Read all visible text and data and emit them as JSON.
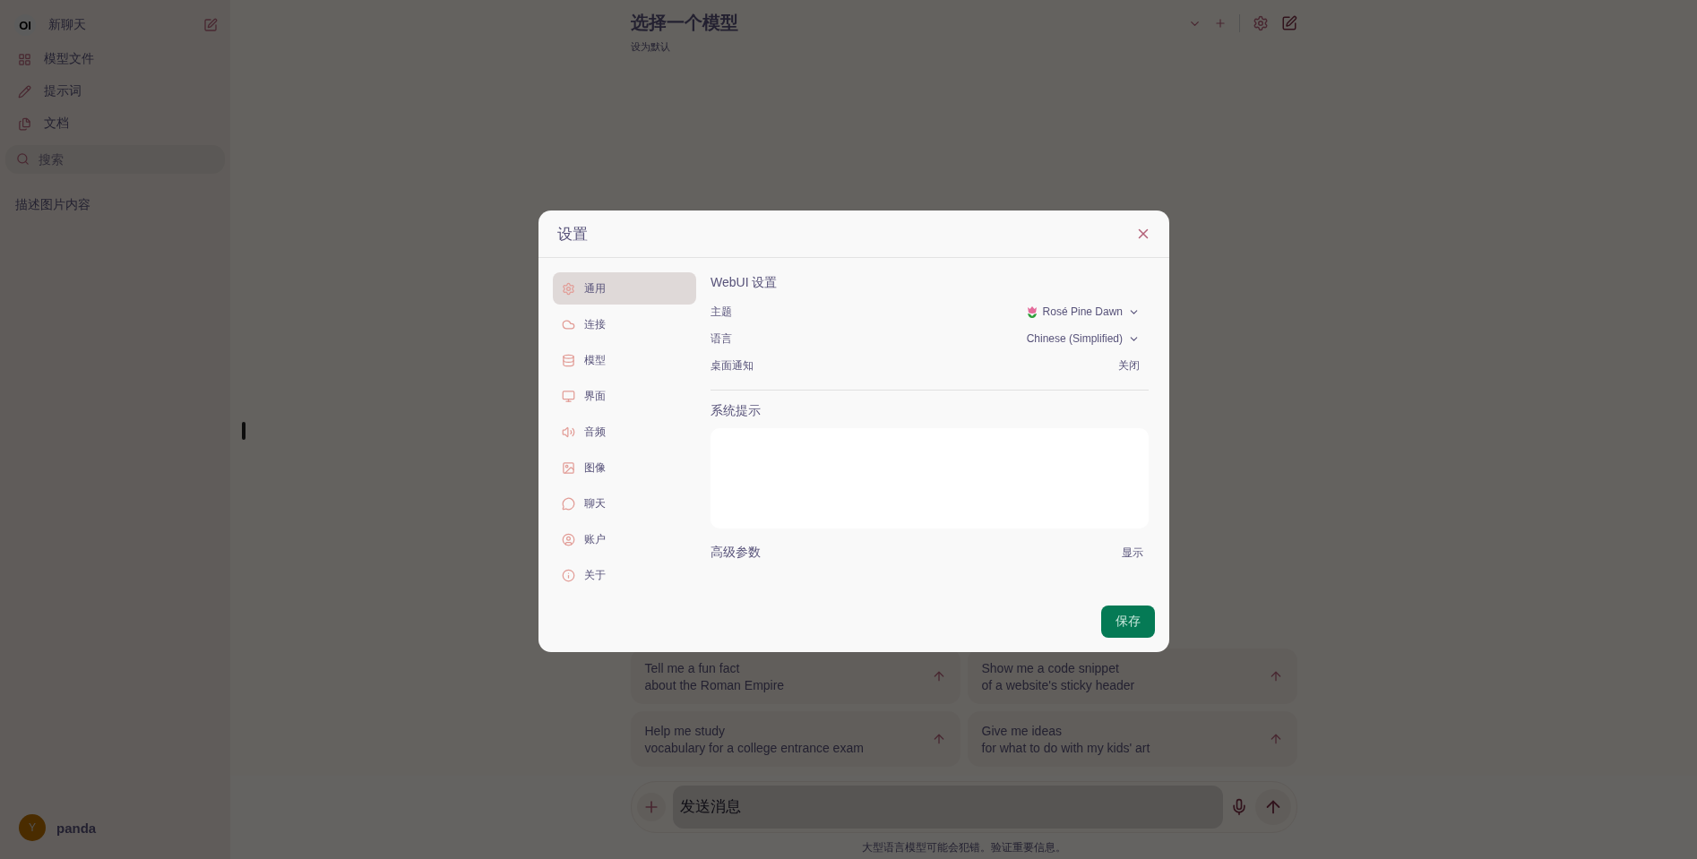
{
  "sidebar": {
    "logo": "OI",
    "new_chat": "新聊天",
    "nav": [
      {
        "label": "模型文件"
      },
      {
        "label": "提示词"
      },
      {
        "label": "文档"
      }
    ],
    "search": {
      "placeholder": "搜索"
    },
    "chats": [
      {
        "title": "描述图片内容"
      }
    ],
    "user": {
      "initial": "Y",
      "name": "panda"
    }
  },
  "header": {
    "title": "选择一个模型",
    "subtitle": "设为默认"
  },
  "suggestions": [
    {
      "title": "Tell me a fun fact",
      "subtitle": "about the Roman Empire"
    },
    {
      "title": "Show me a code snippet",
      "subtitle": "of a website's sticky header"
    },
    {
      "title": "Help me study",
      "subtitle": "vocabulary for a college entrance exam"
    },
    {
      "title": "Give me ideas",
      "subtitle": "for what to do with my kids' art"
    }
  ],
  "composer": {
    "placeholder": "发送消息",
    "disclaimer": "大型语言模型可能会犯错。验证重要信息。"
  },
  "settings_dialog": {
    "title": "设置",
    "tabs": [
      {
        "label": "通用",
        "selected": true
      },
      {
        "label": "连接",
        "selected": false
      },
      {
        "label": "模型",
        "selected": false
      },
      {
        "label": "界面",
        "selected": false
      },
      {
        "label": "音频",
        "selected": false
      },
      {
        "label": "图像",
        "selected": false
      },
      {
        "label": "聊天",
        "selected": false
      },
      {
        "label": "账户",
        "selected": false
      },
      {
        "label": "关于",
        "selected": false
      }
    ],
    "section_title": "WebUI 设置",
    "rows": [
      {
        "kind": "theme",
        "label": "主题",
        "value": "Rosé Pine Dawn"
      },
      {
        "kind": "select",
        "label": "语言",
        "value": "Chinese (Simplified)"
      },
      {
        "kind": "toggle",
        "label": "桌面通知",
        "value": "关闭"
      }
    ],
    "system_prompt": {
      "label": "系统提示"
    },
    "advanced": {
      "label": "高级参数",
      "action": "显示"
    },
    "save": "保存"
  }
}
